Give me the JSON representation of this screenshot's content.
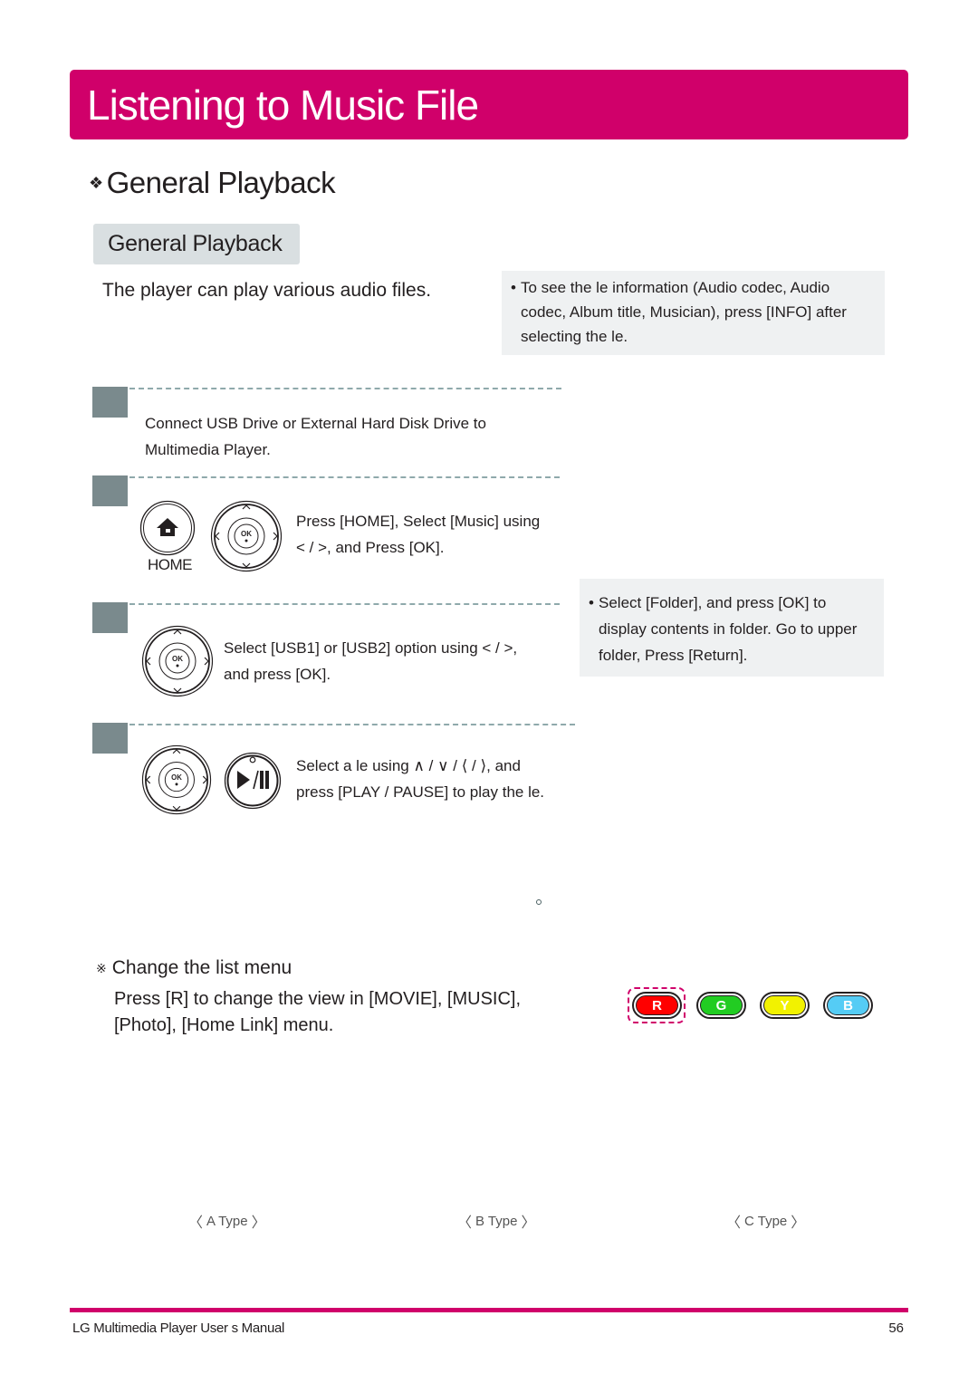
{
  "page": {
    "title": "Listening to Music File",
    "section_heading": "General Playback",
    "section_bullet": "❖",
    "sub_tag": "General Playback",
    "intro": "The player can play various audio files."
  },
  "notes": [
    {
      "bullet": "•",
      "lines": [
        "To see the  le information (Audio codec, Audio",
        "codec, Album title, Musician), press [INFO] after",
        "selecting the  le."
      ]
    },
    {
      "bullet": "•",
      "lines": [
        "Select [Folder], and press [OK] to",
        "display contents in folder. Go to upper",
        "folder, Press [Return]."
      ]
    }
  ],
  "steps": [
    {
      "lines": [
        "Connect USB Drive or External Hard Disk Drive to",
        "Multimedia Player."
      ],
      "icons": []
    },
    {
      "lines": [
        "Press [HOME], Select [Music] using",
        "< / >, and Press [OK]."
      ],
      "icons": [
        "home-button-icon",
        "dpad-ok-icon"
      ],
      "home_label": "HOME"
    },
    {
      "lines": [
        "Select [USB1] or [USB2] option using < / >,",
        "and press [OK]."
      ],
      "icons": [
        "dpad-ok-icon"
      ]
    },
    {
      "lines": [
        "Select a  le using  ∧ / ∨ / ⟨ / ⟩, and",
        "press [PLAY / PAUSE] to play the  le."
      ],
      "icons": [
        "dpad-ok-icon",
        "play-pause-button-icon"
      ]
    }
  ],
  "icon_text": {
    "ok": "OK"
  },
  "change_menu": {
    "mark": "※",
    "heading": "Change the list menu",
    "body_lines": [
      "Press [R] to change the view in [MOVIE], [MUSIC],",
      "[Photo], [Home Link] menu."
    ]
  },
  "color_buttons": [
    {
      "label": "R",
      "color": "#ff0000",
      "highlighted": true
    },
    {
      "label": "G",
      "color": "#22cc22",
      "highlighted": false
    },
    {
      "label": "Y",
      "color": "#f2f200",
      "highlighted": false
    },
    {
      "label": "B",
      "color": "#55ccf5",
      "highlighted": false
    }
  ],
  "view_types": [
    "A Type",
    "B Type",
    "C Type"
  ],
  "chevrons": {
    "left": "〈",
    "right": "〉"
  },
  "footer": {
    "manual_name": "LG Multimedia Player User s Manual",
    "page_number": "56"
  },
  "colors": {
    "accent": "#d0006a",
    "step_marker": "#7a8a8d",
    "note_bg": "#eff1f2",
    "tag_bg": "#d9dfe1"
  }
}
